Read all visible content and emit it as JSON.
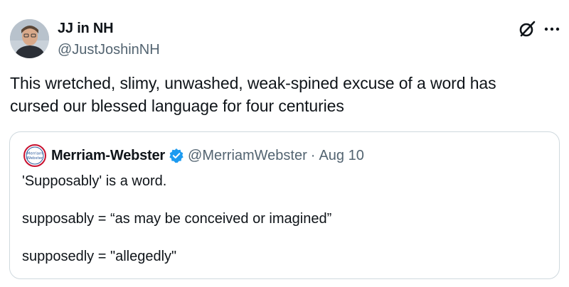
{
  "post": {
    "author": {
      "name": "JJ in NH",
      "handle": "@JustJoshinNH",
      "avatar": "profile-photo"
    },
    "icons": {
      "grok": "grok-icon",
      "more": "more-icon"
    },
    "text_line_1": "This wretched, slimy, unwashed, weak-spined excuse of a word has",
    "text_line_2": "cursed our blessed language for four centuries"
  },
  "quoted_post": {
    "logo_text_1": "Merriam",
    "logo_text_2": "Webster",
    "name": "Merriam-Webster",
    "handle": "@MerriamWebster",
    "separator": "·",
    "date": "Aug 10",
    "verified": true,
    "line_1": "'Supposably' is a word.",
    "line_2": "supposably = “as may be conceived or imagined”",
    "line_3": "supposedly = \"allegedly\""
  },
  "colors": {
    "text": "#0f1419",
    "secondary": "#536471",
    "border": "#cfd9de",
    "verified": "#1d9bf0",
    "mw_blue": "#2f5d9e",
    "mw_red": "#c8102e"
  }
}
